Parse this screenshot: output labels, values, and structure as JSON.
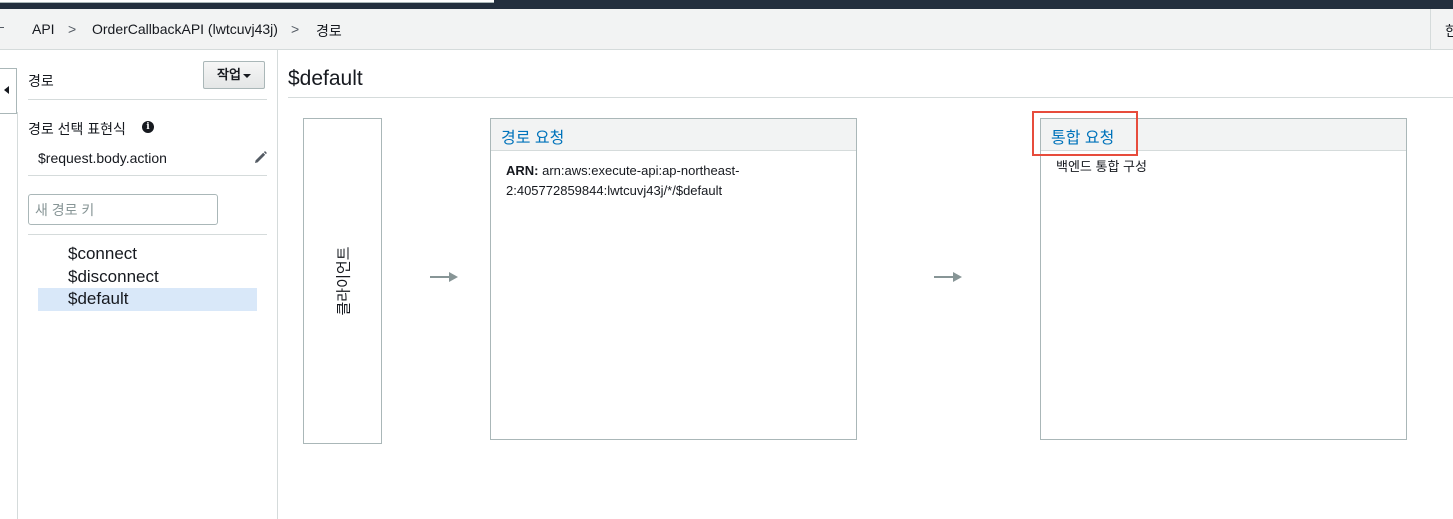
{
  "breadcrumb": {
    "items": [
      "API",
      "OrderCallbackAPI (lwtcuvj43j)",
      "경로"
    ],
    "separator": ">",
    "right_text": "한"
  },
  "sidebar": {
    "title": "경로",
    "actions_button": "작업",
    "route_selection_label": "경로 선택 표현식",
    "route_selection_value": "$request.body.action",
    "new_route_placeholder": "새 경로 키",
    "routes": [
      {
        "label": "$connect",
        "selected": false
      },
      {
        "label": "$disconnect",
        "selected": false
      },
      {
        "label": "$default",
        "selected": true
      }
    ]
  },
  "main": {
    "title": "$default",
    "client_label": "클라이언트",
    "route_request": {
      "header": "경로 요청",
      "arn_label": "ARN:",
      "arn_value": "arn:aws:execute-api:ap-northeast-2:405772859844:lwtcuvj43j/*/$default"
    },
    "integration_request": {
      "header": "통합 요청",
      "body": "백엔드 통합 구성"
    }
  },
  "colors": {
    "link_blue": "#0073bb",
    "highlight_red": "#e74c3c",
    "selected_row": "#d9e8f9",
    "top_nav": "#232f3e"
  },
  "icons": [
    "info-icon",
    "pencil-icon",
    "collapse-arrow-icon",
    "arrow-right-icon"
  ]
}
